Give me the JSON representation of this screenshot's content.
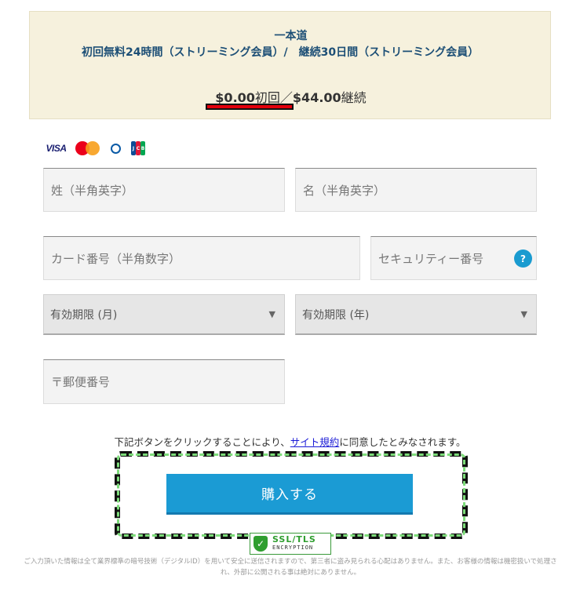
{
  "plan": {
    "site_name": "一本道",
    "plan_name": "初回無料24時間（ストリーミング会員）/　継続30日間（ストリーミング会員）",
    "first_price": "$0.00",
    "first_label": "初回／",
    "recurring_price": "$44.00",
    "recurring_label": "継続"
  },
  "card_brands": [
    "VISA",
    "MasterCard",
    "Diners Club",
    "JCB"
  ],
  "form": {
    "last_name_placeholder": "姓（半角英字）",
    "first_name_placeholder": "名（半角英字）",
    "card_number_placeholder": "カード番号（半角数字）",
    "security_code_placeholder": "セキュリティー番号",
    "security_help": "?",
    "expiry_month_selected": "有効期限 (月)",
    "expiry_year_selected": "有効期限 (年)",
    "zip_placeholder": "〒郵便番号"
  },
  "agreement": {
    "before": "下記ボタンをクリックすることにより、",
    "link": "サイト規約",
    "after": "に同意したとみなされます。"
  },
  "buy_button_label": "購入する",
  "ssl_badge": {
    "line1": "SSL/TLS",
    "line2": "ENCRYPTION"
  },
  "notice": "ご入力頂いた情報は全て業界標準の暗号技術（デジタルID）を用いて安全に送信されますので、第三者に盗み見られる心配はありません。また、お客様の情報は機密扱いで処理され、外部に公開される事は絶対にありません。",
  "colors": {
    "accent_blue": "#1b9bd4",
    "plan_bg": "#f6f1dd",
    "title_blue": "#1d4f76",
    "highlight_red": "#e3000b",
    "dash_green": "#7ddc7a"
  }
}
